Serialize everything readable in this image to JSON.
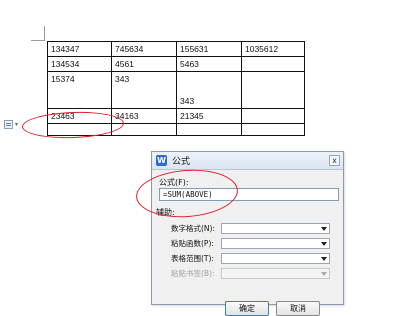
{
  "table": {
    "rows": [
      [
        "134347",
        "745634",
        "155631",
        "1035612"
      ],
      [
        "134534",
        "4561",
        "5463",
        ""
      ],
      [
        [
          "15374",
          ""
        ],
        [
          "343",
          ""
        ],
        [
          "",
          "343"
        ],
        [
          "",
          ""
        ]
      ],
      [
        "23463",
        "34163",
        "21345",
        ""
      ],
      [
        "",
        "",
        "",
        ""
      ]
    ]
  },
  "dialog": {
    "title": "公式",
    "app_icon_letter": "W",
    "close_glyph": "x",
    "formula_label": "公式(F):",
    "formula_value": "=SUM(ABOVE)",
    "aux_label": "辅助:",
    "number_format_label": "数字格式(N):",
    "paste_function_label": "粘贴函数(P):",
    "table_range_label": "表格范围(T):",
    "paste_bookmark_label": "粘贴书签(B):",
    "ok_label": "确定",
    "cancel_label": "取消"
  },
  "colors": {
    "annotation": "#e0202a",
    "accent": "#2d6bd0"
  },
  "icons": [
    "table-handle-icon",
    "wps-writer-icon",
    "close-icon",
    "chevron-down-icon"
  ]
}
